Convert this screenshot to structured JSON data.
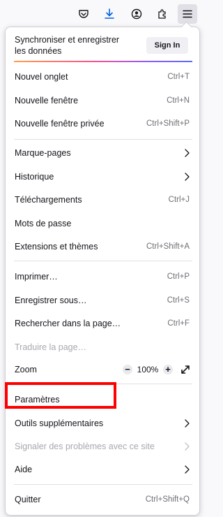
{
  "toolbar": {
    "icons": [
      "pocket-icon",
      "download-icon",
      "account-icon",
      "extensions-icon",
      "menu-icon"
    ]
  },
  "menu": {
    "sync_text": "Synchroniser et enregistrer les données",
    "sign_in_label": "Sign In",
    "new_tab": {
      "label": "Nouvel onglet",
      "shortcut": "Ctrl+T"
    },
    "new_window": {
      "label": "Nouvelle fenêtre",
      "shortcut": "Ctrl+N"
    },
    "private_window": {
      "label": "Nouvelle fenêtre privée",
      "shortcut": "Ctrl+Shift+P"
    },
    "bookmarks": {
      "label": "Marque-pages"
    },
    "history": {
      "label": "Historique"
    },
    "downloads": {
      "label": "Téléchargements",
      "shortcut": "Ctrl+J"
    },
    "passwords": {
      "label": "Mots de passe"
    },
    "addons": {
      "label": "Extensions et thèmes",
      "shortcut": "Ctrl+Shift+A"
    },
    "print": {
      "label": "Imprimer…",
      "shortcut": "Ctrl+P"
    },
    "save_as": {
      "label": "Enregistrer sous…",
      "shortcut": "Ctrl+S"
    },
    "find": {
      "label": "Rechercher dans la page…",
      "shortcut": "Ctrl+F"
    },
    "translate": {
      "label": "Traduire la page…"
    },
    "zoom": {
      "label": "Zoom",
      "minus": "−",
      "value": "100%",
      "plus": "+"
    },
    "settings": {
      "label": "Paramètres"
    },
    "more_tools": {
      "label": "Outils supplémentaires"
    },
    "report": {
      "label": "Signaler des problèmes avec ce site"
    },
    "help": {
      "label": "Aide"
    },
    "quit": {
      "label": "Quitter",
      "shortcut": "Ctrl+Shift+Q"
    }
  },
  "colors": {
    "highlight": "#ff0000",
    "panel_bg": "#ffffff",
    "shortcut_text": "#6e6e76",
    "disabled_text": "#a8a8b0",
    "download_icon": "#0060df"
  }
}
